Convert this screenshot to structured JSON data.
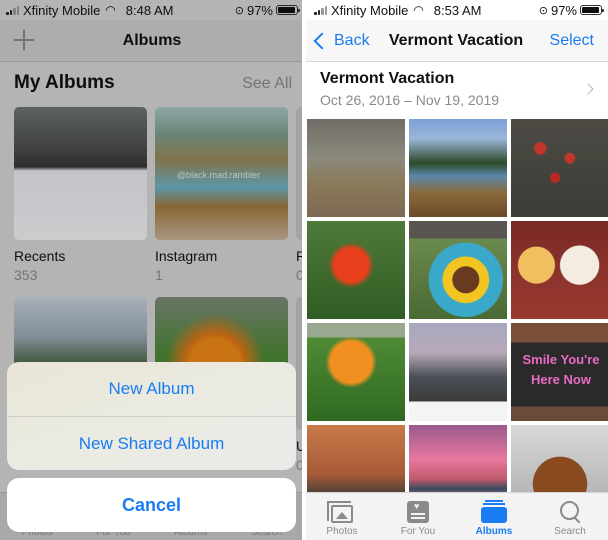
{
  "left_screen": {
    "status_bar": {
      "carrier": "Xfinity Mobile",
      "time": "8:48 AM",
      "battery": "97%"
    },
    "navbar": {
      "title": "Albums",
      "add_icon": "plus-icon"
    },
    "section": {
      "title": "My Albums",
      "see_all": "See All"
    },
    "albums": [
      {
        "name": "Recents",
        "count": "353"
      },
      {
        "name": "Instagram",
        "count": "1"
      },
      {
        "name": "R",
        "count": "0"
      },
      {
        "name": "",
        "count": ""
      },
      {
        "name": "",
        "count": ""
      },
      {
        "name": "U",
        "count": "0"
      }
    ],
    "thumbnail_watermark": "@black.mad.rambler",
    "action_sheet": {
      "items": [
        "New Album",
        "New Shared Album"
      ],
      "cancel": "Cancel"
    },
    "tab_bar": [
      "Photos",
      "For You",
      "Albums",
      "Search"
    ]
  },
  "right_screen": {
    "status_bar": {
      "carrier": "Xfinity Mobile",
      "time": "8:53 AM",
      "battery": "97%"
    },
    "navbar": {
      "back": "Back",
      "title": "Vermont Vacation",
      "select": "Select"
    },
    "album_header": {
      "title": "Vermont Vacation",
      "date_range": "Oct 26, 2016 – Nov 19, 2019"
    },
    "photos": [
      "railroad-tracks",
      "lake-pines",
      "red-berries",
      "red-flower",
      "community-garden-sign",
      "candle-and-mug",
      "orange-flower",
      "harbor-shack",
      "chalkboard-sign",
      "brick-building",
      "pink-sunset",
      "dog"
    ],
    "chalkboard_text": "Smile You're Here Now",
    "tab_bar": {
      "active": "Albums",
      "tabs": [
        {
          "label": "Photos",
          "icon": "photos-icon"
        },
        {
          "label": "For You",
          "icon": "for-you-icon"
        },
        {
          "label": "Albums",
          "icon": "albums-icon"
        },
        {
          "label": "Search",
          "icon": "search-icon"
        }
      ]
    }
  },
  "colors": {
    "accent": "#1a7cf2",
    "secondary_text": "#8a8a8a"
  }
}
